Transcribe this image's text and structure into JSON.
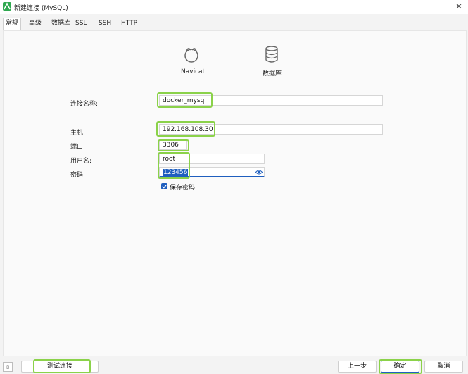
{
  "window": {
    "title": "新建连接 (MySQL)",
    "close_glyph": "✕"
  },
  "tabs": [
    "常规",
    "高级",
    "数据库",
    "SSL",
    "SSH",
    "HTTP"
  ],
  "diagram": {
    "left_label": "Navicat",
    "right_label": "数据库"
  },
  "form": {
    "connection_name": {
      "label": "连接名称:",
      "value": "docker_mysql"
    },
    "host": {
      "label": "主机:",
      "value": "192.168.108.30"
    },
    "port": {
      "label": "端口:",
      "value": "3306"
    },
    "username": {
      "label": "用户名:",
      "value": "root"
    },
    "password": {
      "label": "密码:",
      "value": "123456"
    },
    "save_password": {
      "label": "保存密码",
      "checked": true
    }
  },
  "buttons": {
    "test_connection": "测试连接",
    "previous": "上一步",
    "ok": "确定",
    "cancel": "取消"
  },
  "colors": {
    "highlight": "#8bd24a",
    "accent": "#1f5fbf",
    "app_icon": "#2fa84f"
  },
  "icons": [
    "app-icon",
    "close-icon",
    "navicat-icon",
    "database-icon",
    "eye-icon",
    "panel-toggle-icon"
  ]
}
